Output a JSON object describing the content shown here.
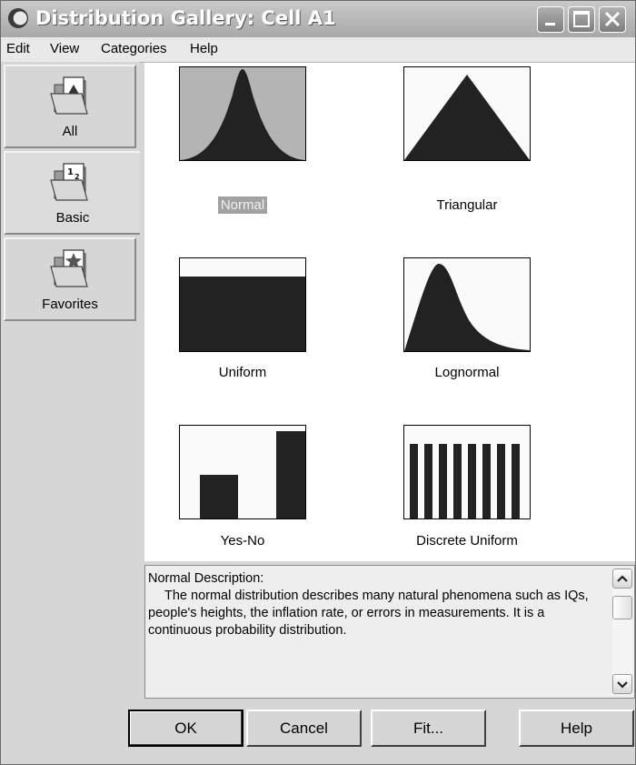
{
  "window": {
    "title": "Distribution Gallery: Cell A1"
  },
  "title_controls": {
    "minimize": "minimize-icon",
    "maximize": "maximize-icon",
    "close": "close-icon"
  },
  "menu": [
    {
      "label": "Edit"
    },
    {
      "label": "View"
    },
    {
      "label": "Categories"
    },
    {
      "label": "Help"
    }
  ],
  "categories": [
    {
      "label": "All",
      "icon": "folder-all-icon",
      "selected": false
    },
    {
      "label": "Basic",
      "icon": "folder-basic-icon",
      "selected": true
    },
    {
      "label": "Favorites",
      "icon": "folder-favorites-icon",
      "selected": false
    }
  ],
  "distributions": [
    {
      "label": "Normal",
      "icon": "normal-distribution-icon",
      "selected": true
    },
    {
      "label": "Triangular",
      "icon": "triangular-distribution-icon",
      "selected": false
    },
    {
      "label": "Uniform",
      "icon": "uniform-distribution-icon",
      "selected": false
    },
    {
      "label": "Lognormal",
      "icon": "lognormal-distribution-icon",
      "selected": false
    },
    {
      "label": "Yes-No",
      "icon": "yes-no-distribution-icon",
      "selected": false
    },
    {
      "label": "Discrete Uniform",
      "icon": "discrete-uniform-distribution-icon",
      "selected": false
    }
  ],
  "description": {
    "title": "Normal Description:",
    "body": "The normal distribution describes many natural phenomena such as IQs, people's heights, the inflation rate, or errors in measurements. It is a continuous probability distribution."
  },
  "buttons": {
    "ok": "OK",
    "cancel": "Cancel",
    "fit": "Fit...",
    "help": "Help"
  },
  "colors": {
    "selection_highlight": "#a2a2a2",
    "chart_fill": "#222222",
    "window_face": "#d6d6d6"
  }
}
